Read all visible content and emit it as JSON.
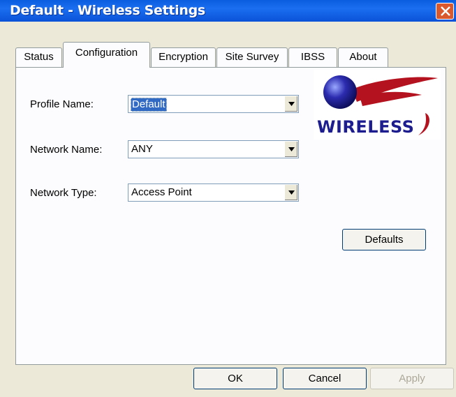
{
  "window": {
    "title": "Default - Wireless Settings"
  },
  "tabs": [
    "Status",
    "Configuration",
    "Encryption",
    "Site Survey",
    "IBSS",
    "About"
  ],
  "active_tab": "Configuration",
  "form": {
    "profile_name": {
      "label": "Profile Name:",
      "value": "Default"
    },
    "network_name": {
      "label": "Network Name:",
      "value": "ANY"
    },
    "network_type": {
      "label": "Network Type:",
      "value": "Access Point"
    }
  },
  "logo": {
    "text": "WIRELESS"
  },
  "buttons": {
    "defaults": "Defaults",
    "ok": "OK",
    "cancel": "Cancel",
    "apply": "Apply"
  },
  "colors": {
    "titlebar": "#0a5ddf",
    "close": "#d9582e",
    "logo_red": "#b4121e",
    "logo_blue": "#1d1d8f",
    "selection": "#316ac5"
  },
  "icons": {
    "close": "close-icon",
    "dropdown": "chevron-down-icon"
  }
}
